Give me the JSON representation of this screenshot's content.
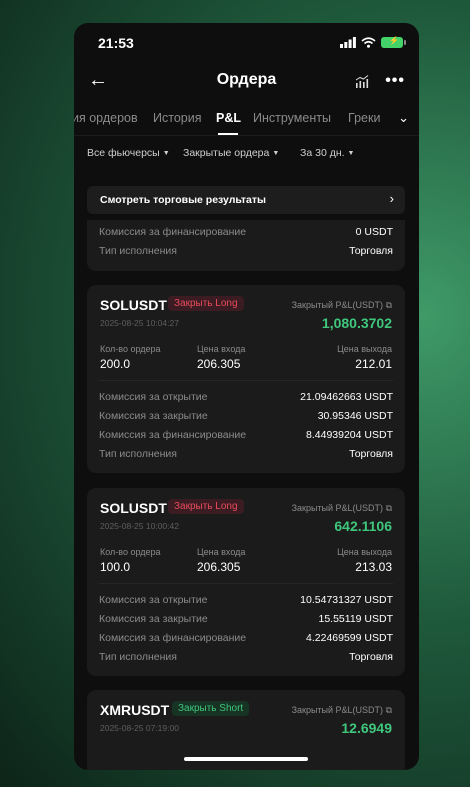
{
  "status": {
    "time": "21:53"
  },
  "nav": {
    "title": "Ордера"
  },
  "tabs": [
    "ия ордеров",
    "История",
    "P&L",
    "Инструменты",
    "Греки"
  ],
  "filters": {
    "futures": "Все фьючерсы",
    "orders": "Закрытые ордера",
    "period": "За 30 дн."
  },
  "results_button": "Смотреть торговые результаты",
  "card0": {
    "rows": [
      {
        "k": "Комиссия за финансирование",
        "v": "0 USDT"
      },
      {
        "k": "Тип исполнения",
        "v": "Торговля"
      }
    ]
  },
  "card1": {
    "symbol": "SOLUSDT",
    "badge": "Закрыть Long",
    "timestamp": "2025-08-25 10:04:27",
    "pnl_label": "Закрытый P&L(USDT)",
    "pnl": "1,080.3702",
    "qty_label": "Кол-во ордера",
    "qty": "200.0",
    "entry_label": "Цена входа",
    "entry": "206.305",
    "exit_label": "Цена выхода",
    "exit": "212.01",
    "rows": [
      {
        "k": "Комиссия за открытие",
        "v": "21.09462663 USDT"
      },
      {
        "k": "Комиссия за закрытие",
        "v": "30.95346 USDT"
      },
      {
        "k": "Комиссия за финансирование",
        "v": "8.44939204 USDT"
      },
      {
        "k": "Тип исполнения",
        "v": "Торговля"
      }
    ]
  },
  "card2": {
    "symbol": "SOLUSDT",
    "badge": "Закрыть Long",
    "timestamp": "2025-08-25 10:00:42",
    "pnl_label": "Закрытый P&L(USDT)",
    "pnl": "642.1106",
    "qty_label": "Кол-во ордера",
    "qty": "100.0",
    "entry_label": "Цена входа",
    "entry": "206.305",
    "exit_label": "Цена выхода",
    "exit": "213.03",
    "rows": [
      {
        "k": "Комиссия за открытие",
        "v": "10.54731327 USDT"
      },
      {
        "k": "Комиссия за закрытие",
        "v": "15.55119 USDT"
      },
      {
        "k": "Комиссия за финансирование",
        "v": "4.22469599 USDT"
      },
      {
        "k": "Тип исполнения",
        "v": "Торговля"
      }
    ]
  },
  "card3": {
    "symbol": "XMRUSDT",
    "badge": "Закрыть Short",
    "timestamp": "2025-08-25 07:19:00",
    "pnl_label": "Закрытый P&L(USDT)",
    "pnl": "12.6949"
  },
  "colors": {
    "profit": "#3fc77c",
    "long_badge": "#ea4c5c",
    "short_badge": "#3fc77c"
  }
}
